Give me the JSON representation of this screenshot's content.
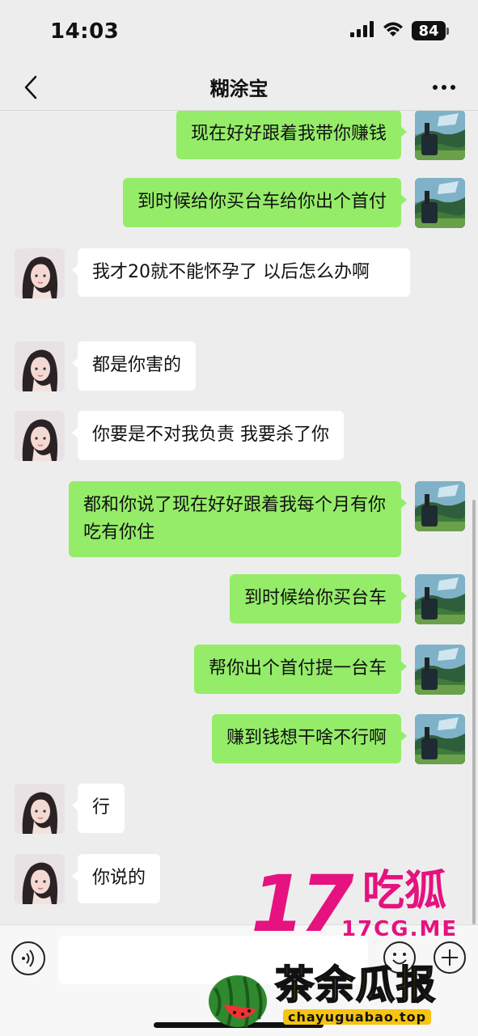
{
  "status": {
    "time": "14:03",
    "battery": "84"
  },
  "header": {
    "title": "糊涂宝"
  },
  "messages": [
    {
      "side": "out",
      "text": "现在好好跟着我带你赚钱"
    },
    {
      "side": "out",
      "text": "到时候给你买台车给你出个首付"
    },
    {
      "side": "in",
      "text": "我才20就不能怀孕了 以后怎么办啊"
    },
    {
      "side": "in",
      "text": "都是你害的"
    },
    {
      "side": "in",
      "text": "你要是不对我负责 我要杀了你"
    },
    {
      "side": "out",
      "text": "都和你说了现在好好跟着我每个月有你吃有你住"
    },
    {
      "side": "out",
      "text": "到时候给你买台车"
    },
    {
      "side": "out",
      "text": "帮你出个首付提一台车"
    },
    {
      "side": "out",
      "text": "赚到钱想干啥不行啊"
    },
    {
      "side": "in",
      "text": "行"
    },
    {
      "side": "in",
      "text": "你说的"
    }
  ],
  "watermark": {
    "number": "17",
    "brand": "吃狐",
    "domain": "17CG.ME",
    "brand2": "茶余瓜报",
    "domain2": "chayuguabao.top"
  },
  "colors": {
    "outgoing_bubble": "#95ec69",
    "incoming_bubble": "#ffffff",
    "background": "#ededed",
    "watermark_pink": "#e5127f",
    "watermark_yellow": "#f6c411"
  },
  "icons": [
    "back-icon",
    "more-icon",
    "voice-icon",
    "emoji-icon",
    "plus-icon",
    "signal-icon",
    "wifi-icon",
    "battery-icon"
  ]
}
